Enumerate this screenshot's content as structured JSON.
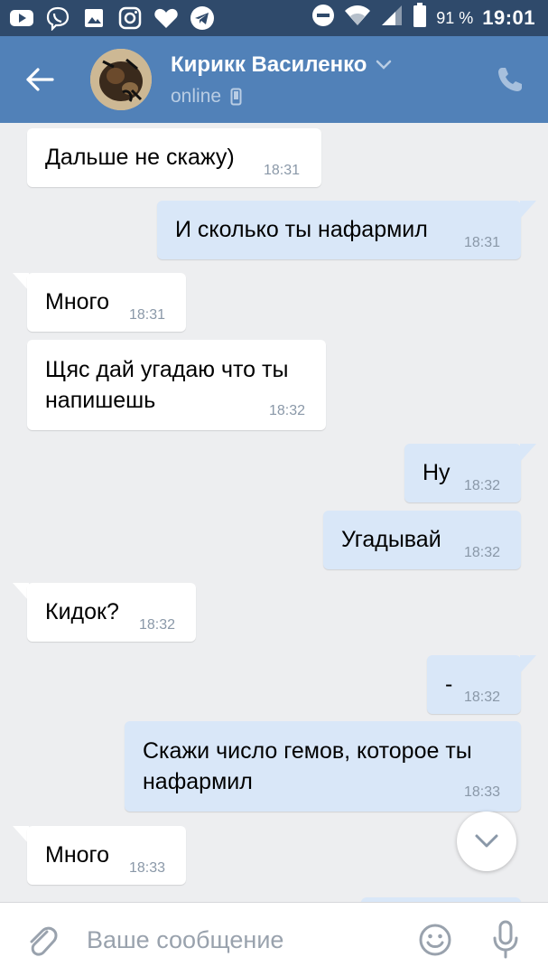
{
  "status_bar": {
    "battery_percent": "91 %",
    "time": "19:01",
    "left_icons": [
      "youtube-icon",
      "viber-icon",
      "gallery-icon",
      "instagram-icon",
      "heart-icon",
      "telegram-icon"
    ],
    "right_icons": [
      "do-not-disturb-icon",
      "wifi-icon",
      "signal-icon",
      "battery-icon"
    ]
  },
  "header": {
    "contact_name": "Кирикк Василенко",
    "status": "online",
    "bg_color": "#5181b8"
  },
  "messages": [
    {
      "direction": "in",
      "text": "Дальше не скажу)",
      "time": "18:31",
      "tail": false
    },
    {
      "direction": "out",
      "text": "И сколько ты нафармил",
      "time": "18:31",
      "tail": true
    },
    {
      "direction": "in",
      "text": "Много",
      "time": "18:31",
      "tail": true
    },
    {
      "direction": "in",
      "text_lines": [
        "Щяс дай угадаю что ты",
        "напишешь"
      ],
      "time": "18:32",
      "tail": false
    },
    {
      "direction": "out",
      "text": "Ну",
      "time": "18:32",
      "tail": true
    },
    {
      "direction": "out",
      "text": "Угадывай",
      "time": "18:32",
      "tail": false
    },
    {
      "direction": "in",
      "text": "Кидок?",
      "time": "18:32",
      "tail": true
    },
    {
      "direction": "out",
      "text": "-",
      "time": "18:32",
      "tail": true
    },
    {
      "direction": "out",
      "text_lines": [
        "Скажи число гемов, которое ты",
        "нафармил"
      ],
      "time": "18:33",
      "tail": false
    },
    {
      "direction": "in",
      "text": "Много",
      "time": "18:33",
      "tail": true
    }
  ],
  "input": {
    "placeholder": "Ваше сообщение",
    "value": ""
  },
  "colors": {
    "incoming_bubble": "#ffffff",
    "outgoing_bubble": "#d9e7f8",
    "chat_background": "#edeef0",
    "status_bar": "#2f4a6b"
  }
}
